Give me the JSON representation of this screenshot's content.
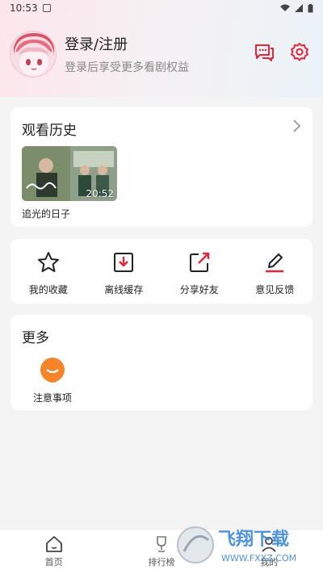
{
  "status": {
    "time": "10:53"
  },
  "profile": {
    "title": "登录/注册",
    "subtitle": "登录后享受更多看剧权益"
  },
  "header_icons": [
    "message-icon",
    "gear-icon"
  ],
  "history": {
    "title": "观看历史",
    "items": [
      {
        "title": "追光的日子",
        "duration": "20:52"
      }
    ]
  },
  "actions": [
    {
      "label": "我的收藏",
      "icon": "star-icon"
    },
    {
      "label": "离线缓存",
      "icon": "download-icon"
    },
    {
      "label": "分享好友",
      "icon": "share-icon"
    },
    {
      "label": "意见反馈",
      "icon": "edit-icon"
    }
  ],
  "more": {
    "title": "更多",
    "items": [
      {
        "label": "注意事项",
        "icon": "notice-icon"
      }
    ]
  },
  "nav": [
    {
      "label": "首页",
      "icon": "home-icon"
    },
    {
      "label": "排行榜",
      "icon": "trophy-icon"
    },
    {
      "label": "我的",
      "icon": "user-icon"
    }
  ],
  "watermark": {
    "text": "飞翔下载",
    "url": "WWW.FXXZ.COM"
  },
  "colors": {
    "accent_red": "#e0283a",
    "notice_orange": "#f4852b"
  }
}
